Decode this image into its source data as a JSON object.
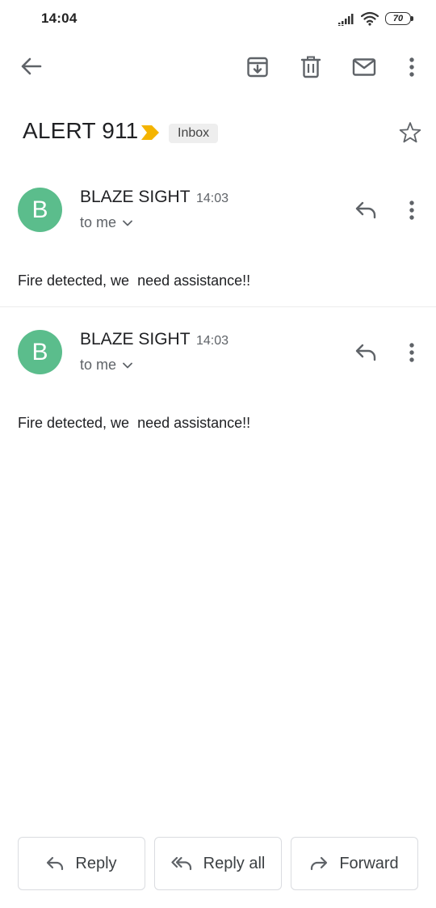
{
  "status_bar": {
    "time": "14:04",
    "battery": "70",
    "icons": [
      "signal-icon",
      "wifi-icon",
      "battery-icon"
    ]
  },
  "toolbar": {
    "icons": [
      "back-arrow-icon",
      "archive-icon",
      "trash-icon",
      "mail-icon",
      "more-vert-icon"
    ]
  },
  "thread": {
    "subject": "ALERT 911",
    "label": "Inbox",
    "importance_color": "#f4b400"
  },
  "messages": [
    {
      "avatar_letter": "B",
      "sender": "BLAZE SIGHT",
      "time": "14:03",
      "recipient": "to me",
      "body": "Fire detected, we  need assistance!!"
    },
    {
      "avatar_letter": "B",
      "sender": "BLAZE SIGHT",
      "time": "14:03",
      "recipient": "to me",
      "body": "Fire detected, we  need assistance!!"
    }
  ],
  "actions": {
    "reply": "Reply",
    "reply_all": "Reply all",
    "forward": "Forward"
  },
  "colors": {
    "avatar": "#5bbd8c",
    "importance": "#f4b400"
  }
}
